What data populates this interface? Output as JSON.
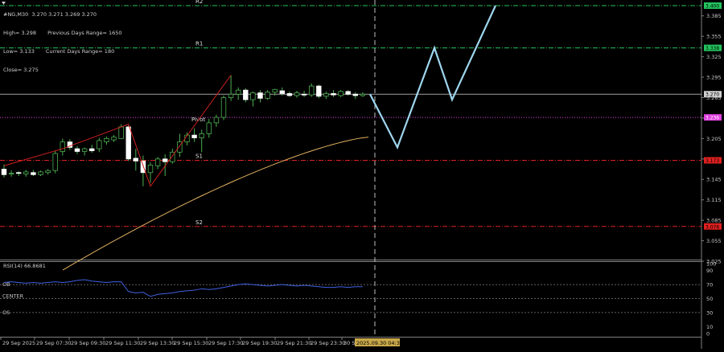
{
  "header": {
    "symbol_line": "#NG,M30  3.270 3.271 3.269 3.270",
    "high": "High= 3.298",
    "low": "Low= 3.133",
    "close": "Close= 3.275",
    "prev_range": "Previous Days Range= 1650",
    "curr_range": "Current Days Range= 180"
  },
  "levels": {
    "r2": {
      "label": "R2",
      "tag": "3.400",
      "price": 3.4,
      "color": "#22c55e"
    },
    "r1": {
      "label": "R1",
      "tag": "3.338",
      "price": 3.338,
      "color": "#22c55e"
    },
    "current": {
      "tag": "3.270",
      "price": 3.27,
      "color": "#d0d0d0"
    },
    "pivot": {
      "label": "Pivot",
      "tag": "3.236",
      "price": 3.236,
      "color": "#e040e0"
    },
    "s1": {
      "label": "S1",
      "tag": "3.173",
      "price": 3.173,
      "color": "#e02020"
    },
    "s2": {
      "label": "S2",
      "tag": "3.076",
      "price": 3.076,
      "color": "#e02020"
    }
  },
  "price_axis": [
    "3.385",
    "3.355",
    "3.325",
    "3.295",
    "3.265",
    "3.235",
    "3.205",
    "3.175",
    "3.145",
    "3.115",
    "3.085",
    "3.055",
    "3.025"
  ],
  "time_axis": [
    "29 Sep 2025",
    "29 Sep 07:30",
    "29 Sep 09:30",
    "29 Sep 11:30",
    "29 Sep 13:30",
    "29 Sep 15:30",
    "29 Sep 17:30",
    "29 Sep 19:30",
    "29 Sep 21:30",
    "29 Sep 23:30",
    "30 Se"
  ],
  "time_marker": "2025.09.30 04:30",
  "rsi": {
    "title": "RSI(14) 66.8681",
    "axis": [
      "100",
      "90",
      "70",
      "50",
      "30",
      "10",
      "0"
    ],
    "labels": {
      "ob": "OB",
      "center": "CENTER",
      "os": "OS"
    }
  },
  "chart_data": {
    "type": "candlestick",
    "symbol": "#NG",
    "timeframe": "M30",
    "candles": [
      {
        "o": 3.16,
        "h": 3.167,
        "l": 3.148,
        "c": 3.152
      },
      {
        "o": 3.153,
        "h": 3.158,
        "l": 3.149,
        "c": 3.154
      },
      {
        "o": 3.155,
        "h": 3.157,
        "l": 3.15,
        "c": 3.154
      },
      {
        "o": 3.153,
        "h": 3.159,
        "l": 3.149,
        "c": 3.156
      },
      {
        "o": 3.155,
        "h": 3.159,
        "l": 3.15,
        "c": 3.152
      },
      {
        "o": 3.152,
        "h": 3.158,
        "l": 3.15,
        "c": 3.156
      },
      {
        "o": 3.155,
        "h": 3.16,
        "l": 3.152,
        "c": 3.158
      },
      {
        "o": 3.158,
        "h": 3.187,
        "l": 3.154,
        "c": 3.183
      },
      {
        "o": 3.186,
        "h": 3.205,
        "l": 3.18,
        "c": 3.2
      },
      {
        "o": 3.2,
        "h": 3.204,
        "l": 3.188,
        "c": 3.192
      },
      {
        "o": 3.19,
        "h": 3.194,
        "l": 3.182,
        "c": 3.186
      },
      {
        "o": 3.186,
        "h": 3.192,
        "l": 3.18,
        "c": 3.19
      },
      {
        "o": 3.19,
        "h": 3.196,
        "l": 3.184,
        "c": 3.187
      },
      {
        "o": 3.19,
        "h": 3.206,
        "l": 3.185,
        "c": 3.202
      },
      {
        "o": 3.2,
        "h": 3.208,
        "l": 3.196,
        "c": 3.205
      },
      {
        "o": 3.203,
        "h": 3.21,
        "l": 3.2,
        "c": 3.207
      },
      {
        "o": 3.205,
        "h": 3.226,
        "l": 3.205,
        "c": 3.222
      },
      {
        "o": 3.222,
        "h": 3.224,
        "l": 3.172,
        "c": 3.175
      },
      {
        "o": 3.176,
        "h": 3.19,
        "l": 3.158,
        "c": 3.172
      },
      {
        "o": 3.172,
        "h": 3.18,
        "l": 3.135,
        "c": 3.155
      },
      {
        "o": 3.155,
        "h": 3.17,
        "l": 3.14,
        "c": 3.166
      },
      {
        "o": 3.165,
        "h": 3.178,
        "l": 3.16,
        "c": 3.175
      },
      {
        "o": 3.175,
        "h": 3.182,
        "l": 3.15,
        "c": 3.171
      },
      {
        "o": 3.171,
        "h": 3.19,
        "l": 3.168,
        "c": 3.185
      },
      {
        "o": 3.185,
        "h": 3.212,
        "l": 3.178,
        "c": 3.2
      },
      {
        "o": 3.2,
        "h": 3.214,
        "l": 3.195,
        "c": 3.21
      },
      {
        "o": 3.21,
        "h": 3.22,
        "l": 3.2,
        "c": 3.206
      },
      {
        "o": 3.206,
        "h": 3.218,
        "l": 3.185,
        "c": 3.212
      },
      {
        "o": 3.212,
        "h": 3.234,
        "l": 3.206,
        "c": 3.228
      },
      {
        "o": 3.228,
        "h": 3.24,
        "l": 3.222,
        "c": 3.236
      },
      {
        "o": 3.236,
        "h": 3.268,
        "l": 3.232,
        "c": 3.265
      },
      {
        "o": 3.265,
        "h": 3.298,
        "l": 3.26,
        "c": 3.27
      },
      {
        "o": 3.27,
        "h": 3.28,
        "l": 3.262,
        "c": 3.276
      },
      {
        "o": 3.276,
        "h": 3.279,
        "l": 3.258,
        "c": 3.262
      },
      {
        "o": 3.262,
        "h": 3.274,
        "l": 3.252,
        "c": 3.272
      },
      {
        "o": 3.272,
        "h": 3.276,
        "l": 3.258,
        "c": 3.264
      },
      {
        "o": 3.264,
        "h": 3.276,
        "l": 3.262,
        "c": 3.273
      },
      {
        "o": 3.273,
        "h": 3.278,
        "l": 3.268,
        "c": 3.277
      },
      {
        "o": 3.275,
        "h": 3.28,
        "l": 3.268,
        "c": 3.271
      },
      {
        "o": 3.271,
        "h": 3.274,
        "l": 3.266,
        "c": 3.268
      },
      {
        "o": 3.268,
        "h": 3.275,
        "l": 3.265,
        "c": 3.272
      },
      {
        "o": 3.27,
        "h": 3.275,
        "l": 3.266,
        "c": 3.269
      },
      {
        "o": 3.269,
        "h": 3.286,
        "l": 3.266,
        "c": 3.282
      },
      {
        "o": 3.282,
        "h": 3.284,
        "l": 3.264,
        "c": 3.267
      },
      {
        "o": 3.267,
        "h": 3.274,
        "l": 3.263,
        "c": 3.271
      },
      {
        "o": 3.271,
        "h": 3.276,
        "l": 3.266,
        "c": 3.269
      },
      {
        "o": 3.268,
        "h": 3.276,
        "l": 3.266,
        "c": 3.274
      },
      {
        "o": 3.274,
        "h": 3.276,
        "l": 3.268,
        "c": 3.27
      },
      {
        "o": 3.27,
        "h": 3.273,
        "l": 3.263,
        "c": 3.268
      },
      {
        "o": 3.268,
        "h": 3.273,
        "l": 3.266,
        "c": 3.27
      }
    ],
    "moving_average": {
      "start": 3.012,
      "end": 3.207,
      "color": "#e0b060"
    },
    "zigzag": [
      [
        0,
        3.165
      ],
      [
        8,
        3.19
      ],
      [
        17,
        3.226
      ],
      [
        20,
        3.135
      ],
      [
        31,
        3.298
      ]
    ],
    "forecast": [
      3.27,
      3.192,
      3.338,
      3.262,
      3.4
    ],
    "rsi_values": [
      73,
      74,
      73,
      72,
      73,
      72,
      73,
      74,
      73,
      74,
      76,
      77,
      75,
      74,
      73,
      74,
      74,
      60,
      58,
      59,
      53,
      56,
      57,
      58,
      60,
      61,
      62,
      64,
      63,
      64,
      66,
      68,
      70,
      71,
      70,
      69,
      68,
      69,
      70,
      69,
      68,
      69,
      68,
      67,
      66,
      66,
      67,
      66,
      67,
      67
    ],
    "rsi_levels": {
      "ob": 70,
      "center": 50,
      "os": 30
    }
  }
}
